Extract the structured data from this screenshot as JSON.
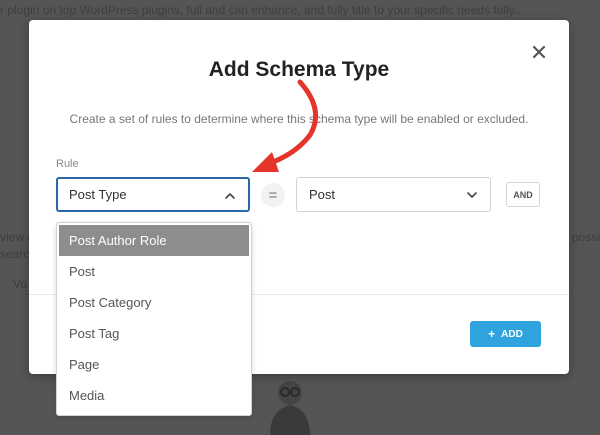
{
  "backdrop": {
    "line1": "r plugin on top WordPress plugins, full and can enhance, and fully title to your specific needs fully...",
    "line2_left": "view a",
    "line2_right": "possible",
    "line3_left": "search",
    "line4_left": "Vo"
  },
  "modal": {
    "title": "Add Schema Type",
    "description": "Create a set of rules to determine where this schema type will be enabled or excluded.",
    "rule_label": "Rule",
    "rule_select_value": "Post Type",
    "equals_symbol": "=",
    "value_select_value": "Post",
    "and_label": "AND",
    "add_label": "ADD"
  },
  "dropdown": {
    "options": [
      "Post Author Role",
      "Post",
      "Post Category",
      "Post Tag",
      "Page",
      "Media"
    ]
  },
  "colors": {
    "accent": "#2ea3dd",
    "focus_border": "#2b66a8",
    "arrow": "#e5352b",
    "highlight": "#8d8d8d"
  }
}
